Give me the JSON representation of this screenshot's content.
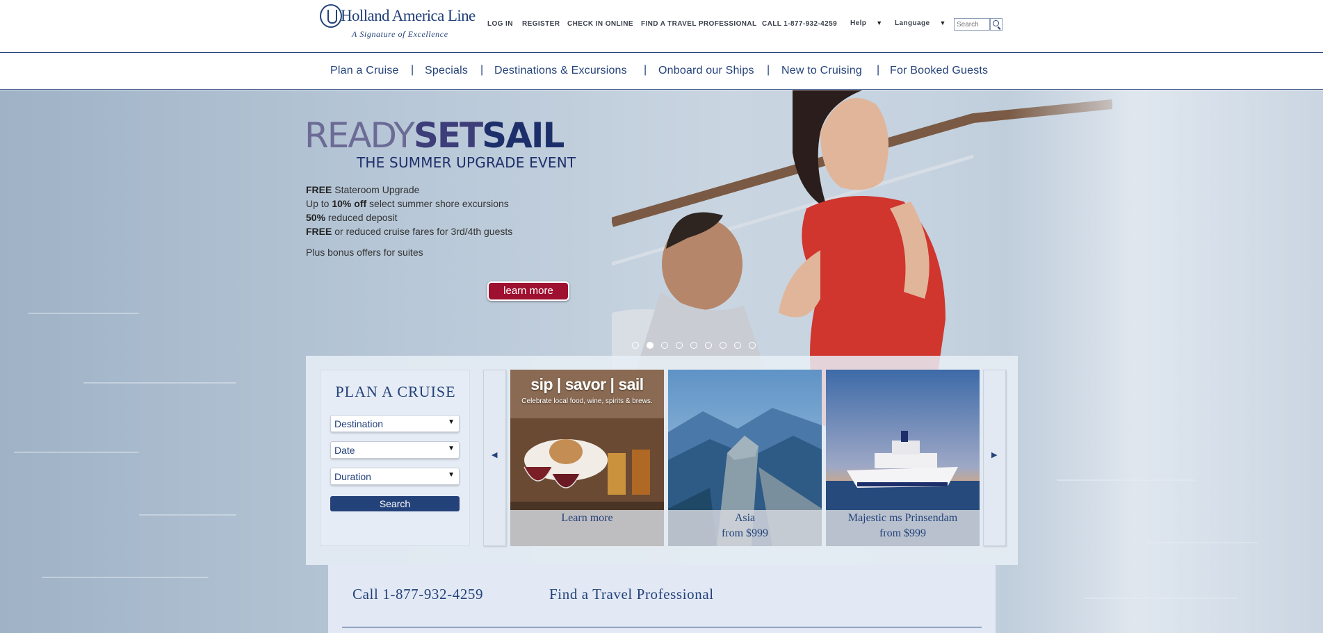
{
  "brand": {
    "name": "Holland America Line",
    "tagline": "A Signature of Excellence"
  },
  "utility_nav": {
    "links": [
      "LOG IN",
      "REGISTER",
      "CHECK IN ONLINE",
      "FIND A TRAVEL PROFESSIONAL",
      "CALL 1-877-932-4259"
    ],
    "help": "Help",
    "language": "Language",
    "search_placeholder": "Search"
  },
  "main_nav": {
    "items": [
      "Plan a Cruise",
      "Specials",
      "Destinations & Excursions",
      "Onboard our Ships",
      "New to Cruising",
      "For Booked Guests"
    ],
    "separator": "|"
  },
  "hero": {
    "headline_ready": "READY",
    "headline_set": "SET",
    "headline_sail": "SAIL",
    "subheadline": "THE SUMMER UPGRADE EVENT",
    "offers": [
      {
        "bold": "FREE",
        "text": " Stateroom Upgrade"
      },
      {
        "pre": "Up to ",
        "bold": "10% off",
        "text": " select summer shore excursions"
      },
      {
        "bold": "50%",
        "text": " reduced deposit"
      },
      {
        "bold": "FREE",
        "text": " or reduced cruise fares for 3rd/4th guests"
      }
    ],
    "bonus": "Plus bonus offers for suites",
    "cta": "learn more",
    "slide_count": 9,
    "active_slide": 2
  },
  "plan_cruise": {
    "title": "PLAN A CRUISE",
    "destination": "Destination",
    "date": "Date",
    "duration": "Duration",
    "search_label": "Search"
  },
  "carousel": {
    "prev_icon": "◀",
    "next_icon": "▶",
    "tiles": [
      {
        "heading": "sip | savor | sail",
        "subheading": "Celebrate local food, wine, spirits & brews.",
        "line1": "Learn more",
        "line2": ""
      },
      {
        "heading": "",
        "subheading": "",
        "line1": "Asia",
        "line2": "from $999"
      },
      {
        "heading": "",
        "subheading": "",
        "line1": "Majestic ms Prinsendam",
        "line2": "from $999"
      }
    ]
  },
  "contact": {
    "phone": "Call 1-877-932-4259",
    "find": "Find a Travel Professional"
  },
  "colors": {
    "navy": "#24427a",
    "cta_red": "#9e1030",
    "panel": "#e6ecf5"
  }
}
